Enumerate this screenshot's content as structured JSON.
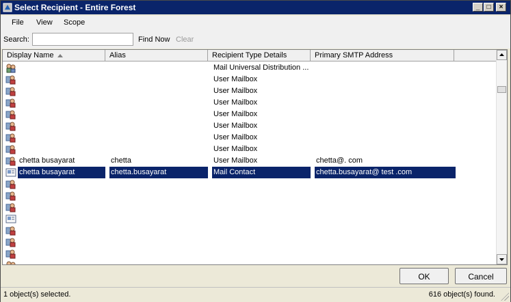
{
  "window": {
    "title": "Select Recipient - Entire Forest",
    "controls": {
      "minimize": "_",
      "maximize": "□",
      "close": "×"
    }
  },
  "menu": [
    "File",
    "View",
    "Scope"
  ],
  "search": {
    "label": "Search:",
    "value": "",
    "find_now": "Find Now",
    "clear": "Clear"
  },
  "columns": [
    "Display Name",
    "Alias",
    "Recipient Type Details",
    "Primary SMTP Address"
  ],
  "rows": [
    {
      "icon": "distribution-group-icon",
      "name": "",
      "alias": "",
      "type": "Mail Universal Distribution ...",
      "smtp": ""
    },
    {
      "icon": "user-mailbox-icon",
      "name": "",
      "alias": "",
      "type": "User Mailbox",
      "smtp": ""
    },
    {
      "icon": "user-mailbox-icon",
      "name": "",
      "alias": "",
      "type": "User Mailbox",
      "smtp": ""
    },
    {
      "icon": "user-mailbox-icon",
      "name": "",
      "alias": "",
      "type": "User Mailbox",
      "smtp": ""
    },
    {
      "icon": "user-mailbox-icon",
      "name": "",
      "alias": "",
      "type": "User Mailbox",
      "smtp": ""
    },
    {
      "icon": "user-mailbox-icon",
      "name": "",
      "alias": "",
      "type": "User Mailbox",
      "smtp": ""
    },
    {
      "icon": "user-mailbox-icon",
      "name": "",
      "alias": "",
      "type": "User Mailbox",
      "smtp": ""
    },
    {
      "icon": "user-mailbox-icon",
      "name": "",
      "alias": "",
      "type": "User Mailbox",
      "smtp": ""
    },
    {
      "icon": "user-mailbox-icon",
      "name": "chetta busayarat",
      "alias": "chetta",
      "type": "User Mailbox",
      "smtp": "chetta@.            com"
    },
    {
      "icon": "mail-contact-icon",
      "name": "chetta busayarat",
      "alias": "chetta.busayarat",
      "type": "Mail Contact",
      "smtp": "chetta.busayarat@     test    .com",
      "selected": true
    },
    {
      "icon": "user-mailbox-icon",
      "name": "",
      "alias": "",
      "type": "",
      "smtp": ""
    },
    {
      "icon": "user-mailbox-icon",
      "name": "",
      "alias": "",
      "type": "",
      "smtp": ""
    },
    {
      "icon": "user-mailbox-icon",
      "name": "",
      "alias": "",
      "type": "",
      "smtp": ""
    },
    {
      "icon": "mail-contact-icon",
      "name": "",
      "alias": "",
      "type": "",
      "smtp": ""
    },
    {
      "icon": "user-mailbox-icon",
      "name": "",
      "alias": "",
      "type": "",
      "smtp": ""
    },
    {
      "icon": "user-mailbox-icon",
      "name": "",
      "alias": "",
      "type": "",
      "smtp": ""
    },
    {
      "icon": "user-mailbox-icon",
      "name": "",
      "alias": "",
      "type": "",
      "smtp": ""
    },
    {
      "icon": "distribution-group-icon",
      "name": "",
      "alias": "",
      "type": "",
      "smtp": ""
    }
  ],
  "buttons": {
    "ok": "OK",
    "cancel": "Cancel"
  },
  "status": {
    "selected": "1 object(s) selected.",
    "found": "616 object(s) found."
  },
  "colors": {
    "titlebar": "#0a246a",
    "selection": "#0a246a",
    "window_bg": "#ece9d8"
  }
}
